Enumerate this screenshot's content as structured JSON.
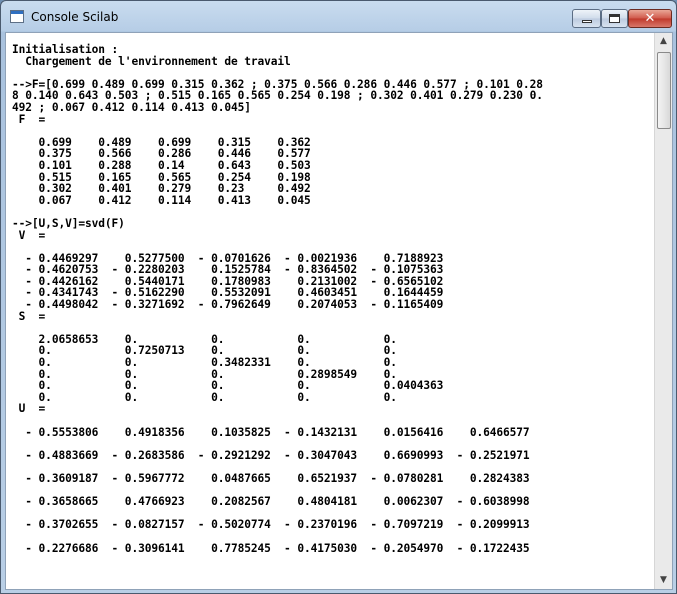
{
  "window": {
    "title": "Console Scilab",
    "icon": "scilab-app-icon"
  },
  "controls": {
    "minimize": "minimize-icon",
    "maximize": "maximize-icon",
    "close": "close-icon",
    "close_glyph": "✕"
  },
  "console_lines": [
    "Initialisation :",
    "  Chargement de l'environnement de travail",
    "",
    "-->F=[0.699 0.489 0.699 0.315 0.362 ; 0.375 0.566 0.286 0.446 0.577 ; 0.101 0.28",
    "8 0.140 0.643 0.503 ; 0.515 0.165 0.565 0.254 0.198 ; 0.302 0.401 0.279 0.230 0.",
    "492 ; 0.067 0.412 0.114 0.413 0.045]",
    " F  =",
    "",
    "    0.699    0.489    0.699    0.315    0.362",
    "    0.375    0.566    0.286    0.446    0.577",
    "    0.101    0.288    0.14     0.643    0.503",
    "    0.515    0.165    0.565    0.254    0.198",
    "    0.302    0.401    0.279    0.23     0.492",
    "    0.067    0.412    0.114    0.413    0.045",
    "",
    "-->[U,S,V]=svd(F)",
    " V  =",
    "",
    "  - 0.4469297    0.5277500  - 0.0701626  - 0.0021936    0.7188923",
    "  - 0.4620753  - 0.2280203    0.1525784  - 0.8364502  - 0.1075363",
    "  - 0.4426162    0.5440171    0.1780983    0.2131002  - 0.6565102",
    "  - 0.4341743  - 0.5162290    0.5532091    0.4603451    0.1644459",
    "  - 0.4498042  - 0.3271692  - 0.7962649    0.2074053  - 0.1165409",
    " S  =",
    "",
    "    2.0658653    0.           0.           0.           0.",
    "    0.           0.7250713    0.           0.           0.",
    "    0.           0.           0.3482331    0.           0.",
    "    0.           0.           0.           0.2898549    0.",
    "    0.           0.           0.           0.           0.0404363",
    "    0.           0.           0.           0.           0.",
    " U  =",
    "",
    "  - 0.5553806    0.4918356    0.1035825  - 0.1432131    0.0156416    0.6466577",
    "",
    "  - 0.4883669  - 0.2683586  - 0.2921292  - 0.3047043    0.6690993  - 0.2521971",
    "",
    "  - 0.3609187  - 0.5967772    0.0487665    0.6521937  - 0.0780281    0.2824383",
    "",
    "  - 0.3658665    0.4766923    0.2082567    0.4804181    0.0062307  - 0.6038998",
    "",
    "  - 0.3702655  - 0.0827157  - 0.5020774  - 0.2370196  - 0.7097219  - 0.2099913",
    "",
    "  - 0.2276686  - 0.3096141    0.7785245  - 0.4175030  - 0.2054970  - 0.1722435"
  ],
  "scrollbar": {
    "up_glyph": "▲",
    "down_glyph": "▼"
  }
}
